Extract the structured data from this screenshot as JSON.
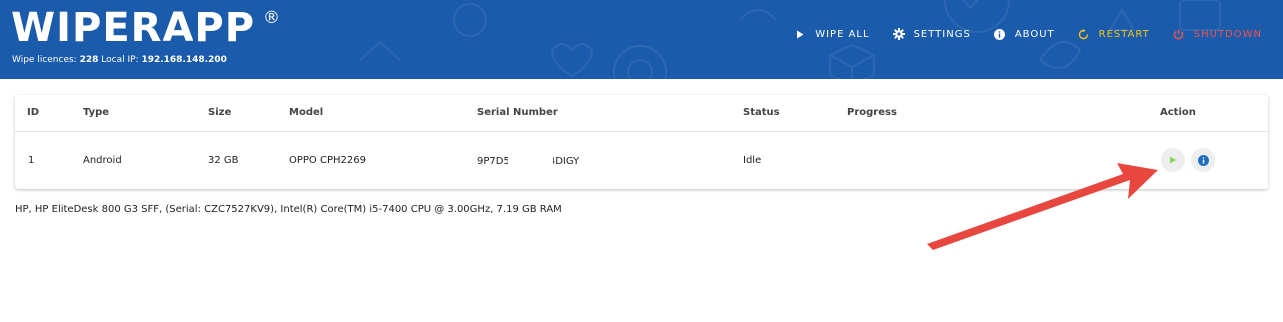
{
  "header": {
    "logo_text": "WIPERAPP",
    "registered_mark": "®",
    "licences_label": "Wipe licences:",
    "licences_value": "228",
    "ip_label": "Local IP:",
    "ip_value": "192.168.148.200",
    "nav": [
      {
        "label": "WIPE ALL",
        "icon": "play-icon"
      },
      {
        "label": "SETTINGS",
        "icon": "gear-icon"
      },
      {
        "label": "ABOUT",
        "icon": "info-icon"
      },
      {
        "label": "RESTART",
        "icon": "restart-icon",
        "color": "#f5c518"
      },
      {
        "label": "SHUTDOWN",
        "icon": "power-icon",
        "color": "#ef5350"
      }
    ]
  },
  "table": {
    "columns": [
      "ID",
      "Type",
      "Size",
      "Model",
      "Serial Number",
      "Status",
      "Progress",
      "Action"
    ],
    "rows": [
      {
        "id": "1",
        "type": "Android",
        "size": "32 GB",
        "model": "OPPO CPH2269",
        "serial_start": "9P7D5",
        "serial_end": "4DIGY",
        "status": "Idle",
        "progress": ""
      }
    ]
  },
  "system_info": "HP, HP EliteDesk 800 G3 SFF, (Serial: CZC7527KV9), Intel(R) Core(TM) i5-7400 CPU @ 3.00GHz, 7.19 GB RAM",
  "colors": {
    "header_bg": "#1b5bab",
    "restart": "#f5c518",
    "shutdown": "#ef5350",
    "play_green": "#7ed957",
    "info_blue": "#1e6fc2",
    "annotation_arrow": "#e8473f"
  }
}
